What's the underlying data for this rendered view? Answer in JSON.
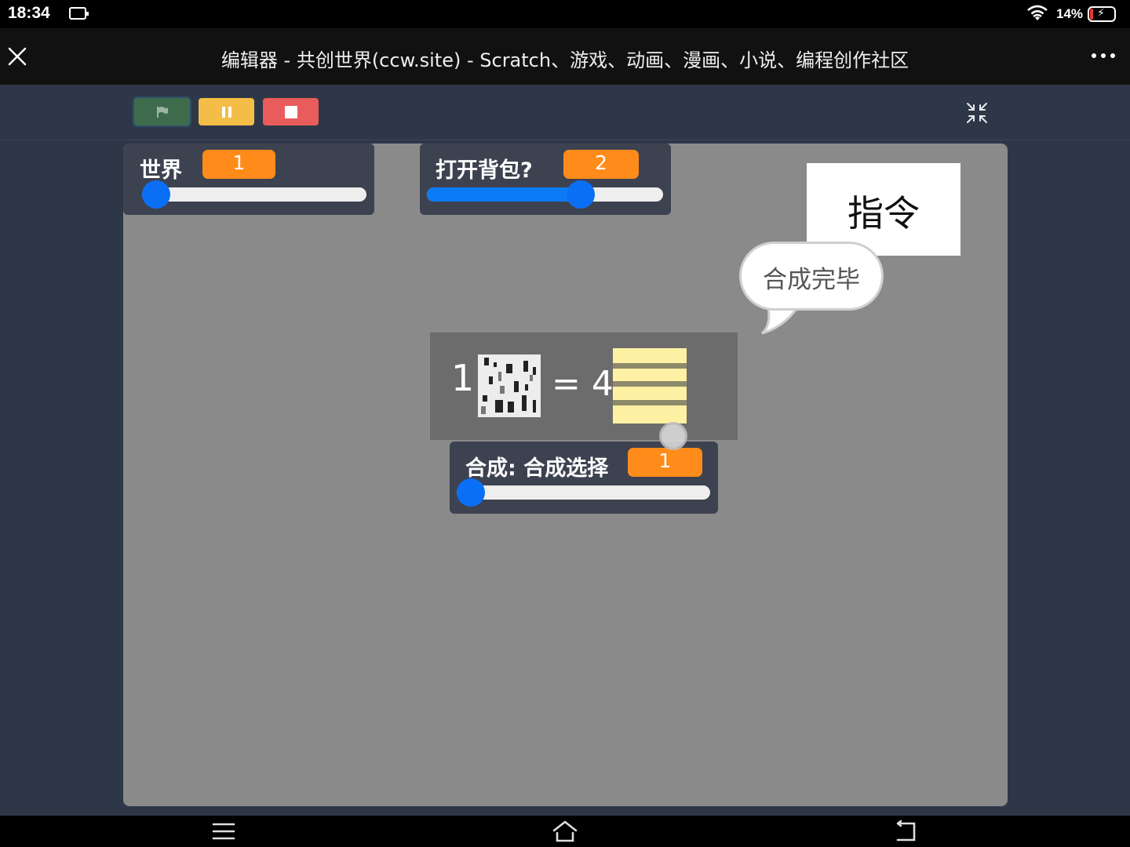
{
  "status_bar": {
    "time": "18:34",
    "battery_percent": "14%",
    "battery_level": 0.14,
    "battery_color": "#e53935",
    "icons": [
      "screen-cast-icon",
      "wifi-icon",
      "battery-charging-icon"
    ]
  },
  "title_bar": {
    "title": "编辑器 - 共创世界(ccw.site) - Scratch、游戏、动画、漫画、小说、编程创作社区",
    "close_icon": "close-icon",
    "more_icon": "more-dots-icon"
  },
  "controls": {
    "buttons": [
      {
        "name": "green-flag",
        "icon": "flag-icon",
        "color": "#3e6b4c"
      },
      {
        "name": "pause",
        "icon": "pause-icon",
        "color": "#f4bd47"
      },
      {
        "name": "stop",
        "icon": "stop-icon",
        "color": "#e95c5c"
      }
    ],
    "exit_fullscreen_icon": "shrink-icon"
  },
  "stage": {
    "background": "#8a8a8a",
    "monitors": [
      {
        "label": "世界",
        "value": "1",
        "slider_fraction": 0.0
      },
      {
        "label": "打开背包?",
        "value": "2",
        "slider_fraction": 0.65
      },
      {
        "label": "合成: 合成选择",
        "value": "1",
        "slider_fraction": 0.0
      }
    ],
    "command_box": {
      "text": "指令"
    },
    "speech_bubble": {
      "text": "合成完毕"
    },
    "recipe": {
      "input_qty": "1",
      "input_icon": "birch-log-icon",
      "equals": "= 4",
      "output_icon": "birch-planks-icon"
    }
  },
  "nav_bar": {
    "icons": [
      "menu-icon",
      "home-icon",
      "back-icon"
    ]
  }
}
